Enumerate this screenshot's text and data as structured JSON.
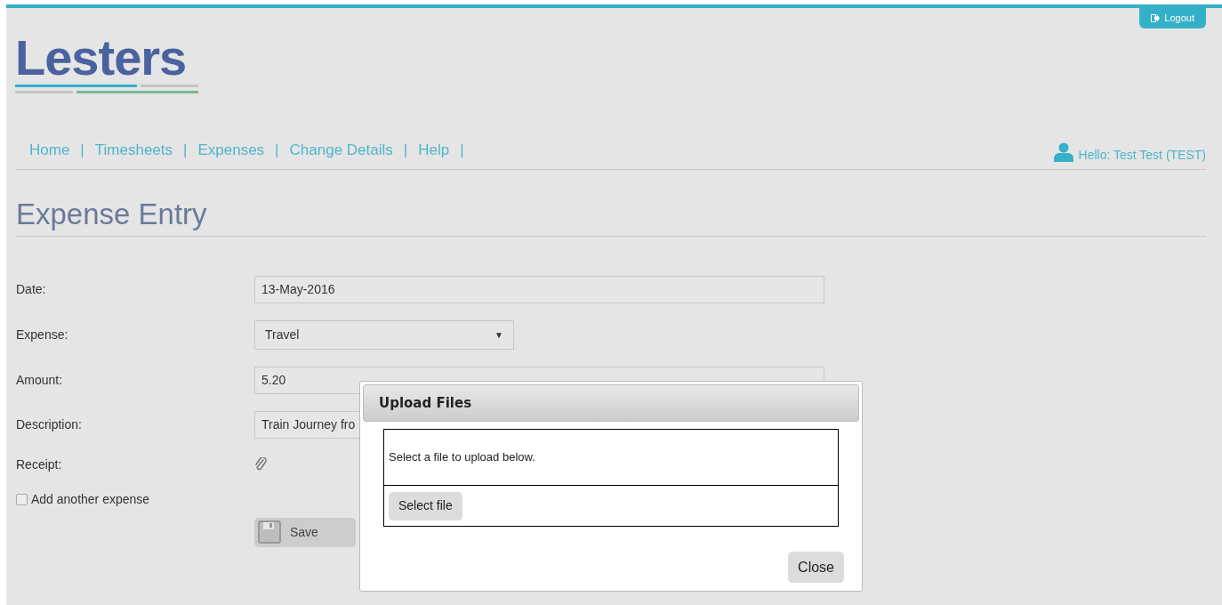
{
  "logo": {
    "text": "Lesters"
  },
  "logout": {
    "label": "Logout"
  },
  "nav": [
    {
      "label": "Home"
    },
    {
      "label": "Timesheets"
    },
    {
      "label": "Expenses"
    },
    {
      "label": "Change Details"
    },
    {
      "label": "Help"
    }
  ],
  "nav_separator": "|",
  "greeting": "Hello: Test Test (TEST)",
  "page_title": "Expense Entry",
  "form": [
    {
      "kind": "text",
      "label": "Date:",
      "value": "13-May-2016"
    },
    {
      "kind": "select",
      "label": "Expense:",
      "value": "Travel",
      "arrow": "▼"
    },
    {
      "kind": "text",
      "label": "Amount:",
      "value": "5.20"
    },
    {
      "kind": "text",
      "label": "Description:",
      "value": "Train Journey fro"
    },
    {
      "kind": "attachment",
      "label": "Receipt:"
    }
  ],
  "add_another": {
    "label": "Add another expense",
    "checked": false
  },
  "save": {
    "label": "Save"
  },
  "dialog": {
    "title": "Upload Files",
    "message": "Select a file to upload below.",
    "select_button": "Select file",
    "close_button": "Close"
  }
}
